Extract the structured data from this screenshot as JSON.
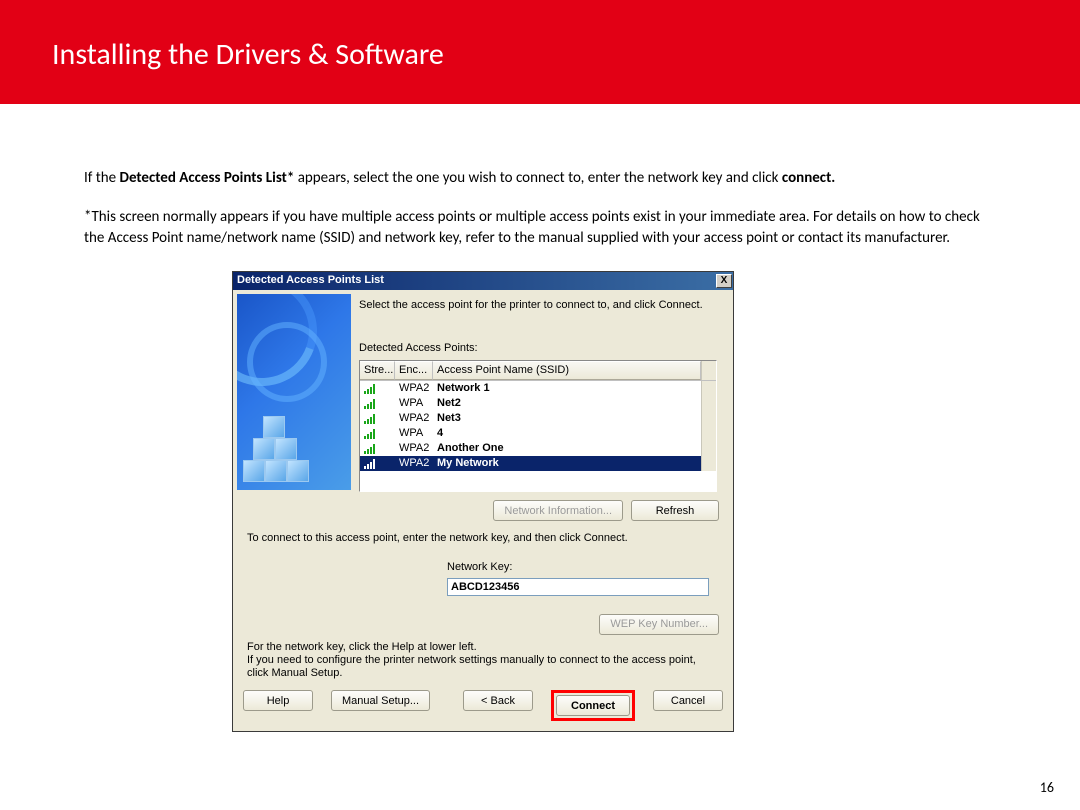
{
  "header": {
    "title": "Installing  the Drivers & Software"
  },
  "intro": {
    "prefix": "If the ",
    "bold1": "Detected Access Points List*",
    "mid": " appears,  select the one you wish to connect to, enter the network key and click ",
    "bold2": "connect."
  },
  "note": "*This screen normally appears if you have multiple access points or multiple access points exist in your immediate area. For details on how to check the Access Point name/network name (SSID) and network key, refer to the manual supplied with your access point or contact its manufacturer.",
  "dialog": {
    "title": "Detected Access Points List",
    "close": "X",
    "instruction": "Select the access point for the printer to connect to, and click Connect.",
    "list_label": "Detected Access Points:",
    "columns": {
      "stre": "Stre...",
      "enc": "Enc...",
      "ssid": "Access Point Name (SSID)"
    },
    "rows": [
      {
        "enc": "WPA2",
        "ssid": "Network 1",
        "selected": false
      },
      {
        "enc": "WPA",
        "ssid": "Net2",
        "selected": false
      },
      {
        "enc": "WPA2",
        "ssid": "Net3",
        "selected": false
      },
      {
        "enc": "WPA",
        "ssid": "4",
        "selected": false
      },
      {
        "enc": "WPA2",
        "ssid": "Another One",
        "selected": false
      },
      {
        "enc": "WPA2",
        "ssid": "My Network",
        "selected": true
      }
    ],
    "network_info_btn": "Network Information...",
    "refresh_btn": "Refresh",
    "mid_text": "To connect to this access point, enter the network key, and then click Connect.",
    "key_label": "Network Key:",
    "key_value": "ABCD123456",
    "wep_btn": "WEP Key Number...",
    "footer_note": "For the network key, click the Help at lower left.\nIf you need to configure the printer network settings manually to connect to the access point, click Manual Setup.",
    "buttons": {
      "help": "Help",
      "manual": "Manual Setup...",
      "back": "< Back",
      "connect": "Connect",
      "cancel": "Cancel"
    }
  },
  "page_number": "16"
}
